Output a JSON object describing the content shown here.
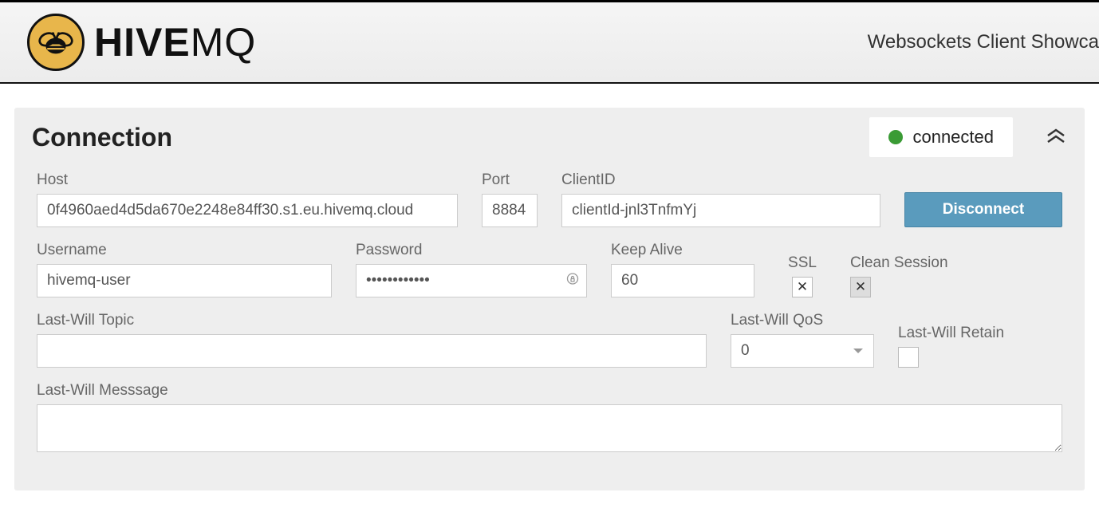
{
  "header": {
    "brand_left": "HIVE",
    "brand_right": "MQ",
    "tagline": "Websockets Client Showca"
  },
  "panel": {
    "title": "Connection",
    "status_text": "connected"
  },
  "labels": {
    "host": "Host",
    "port": "Port",
    "clientid": "ClientID",
    "username": "Username",
    "password": "Password",
    "keepalive": "Keep Alive",
    "ssl": "SSL",
    "cleansession": "Clean Session",
    "lwt": "Last-Will Topic",
    "lwq": "Last-Will QoS",
    "lwr": "Last-Will Retain",
    "lwm": "Last-Will Messsage"
  },
  "values": {
    "host": "0f4960aed4d5da670e2248e84ff30.s1.eu.hivemq.cloud",
    "port": "8884",
    "clientid": "clientId-jnl3TnfmYj",
    "username": "hivemq-user",
    "password": "••••••••••••",
    "keepalive": "60",
    "ssl_checked": "✕",
    "clean_checked": "✕",
    "lwt": "",
    "lwq": "0",
    "lwm": ""
  },
  "buttons": {
    "disconnect": "Disconnect"
  }
}
